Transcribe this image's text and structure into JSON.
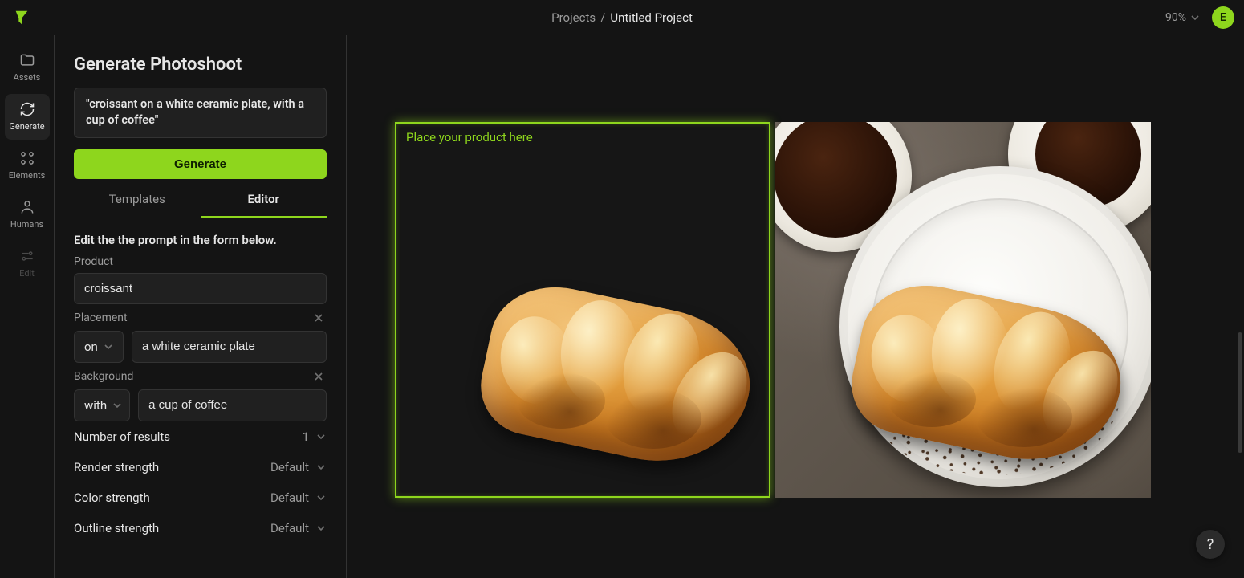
{
  "header": {
    "breadcrumb_root": "Projects",
    "breadcrumb_sep": "/",
    "project_title": "Untitled Project",
    "zoom": "90%",
    "avatar_initial": "E"
  },
  "nav": {
    "items": [
      {
        "id": "assets",
        "label": "Assets"
      },
      {
        "id": "generate",
        "label": "Generate"
      },
      {
        "id": "elements",
        "label": "Elements"
      },
      {
        "id": "humans",
        "label": "Humans"
      },
      {
        "id": "edit",
        "label": "Edit"
      }
    ]
  },
  "panel": {
    "title": "Generate Photoshoot",
    "prompt_display": "\"croissant on a white ceramic plate, with a cup of coffee\"",
    "generate_label": "Generate",
    "tabs": {
      "templates": "Templates",
      "editor": "Editor"
    },
    "editor_hint": "Edit the the prompt in the form below.",
    "fields": {
      "product_label": "Product",
      "product_value": "croissant",
      "placement_label": "Placement",
      "placement_prep": "on",
      "placement_value": "a white ceramic plate",
      "background_label": "Background",
      "background_prep": "with",
      "background_value": "a cup of coffee"
    },
    "settings": {
      "num_results_label": "Number of results",
      "num_results_value": "1",
      "render_strength_label": "Render strength",
      "render_strength_value": "Default",
      "color_strength_label": "Color strength",
      "color_strength_value": "Default",
      "outline_strength_label": "Outline strength",
      "outline_strength_value": "Default"
    }
  },
  "canvas": {
    "placeholder_hint": "Place your product here"
  },
  "help_label": "?"
}
